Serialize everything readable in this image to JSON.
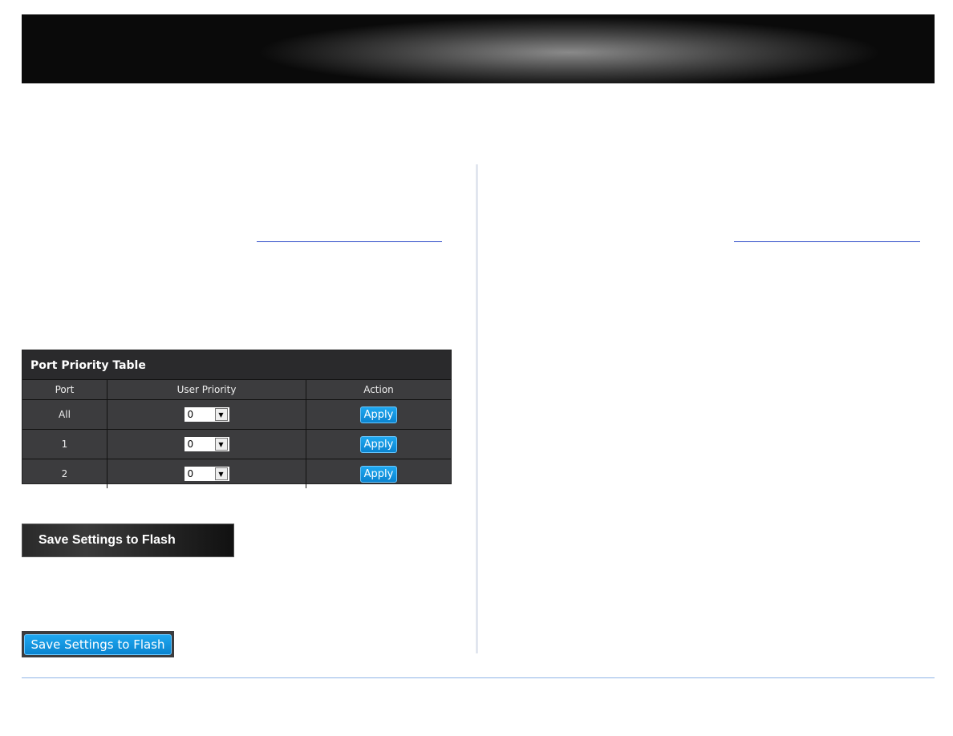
{
  "port_priority_table": {
    "title": "Port Priority Table",
    "headers": [
      "Port",
      "User Priority",
      "Action"
    ],
    "rows": [
      {
        "port": "All",
        "priority": "0",
        "action": "Apply"
      },
      {
        "port": "1",
        "priority": "0",
        "action": "Apply"
      },
      {
        "port": "2",
        "priority": "0",
        "action": "Apply"
      }
    ]
  },
  "menu_save_label": "Save Settings to Flash",
  "save_button_label": "Save Settings to Flash",
  "colors": {
    "accent": "#0a84d0",
    "footer_line": "#8fb5e6"
  }
}
